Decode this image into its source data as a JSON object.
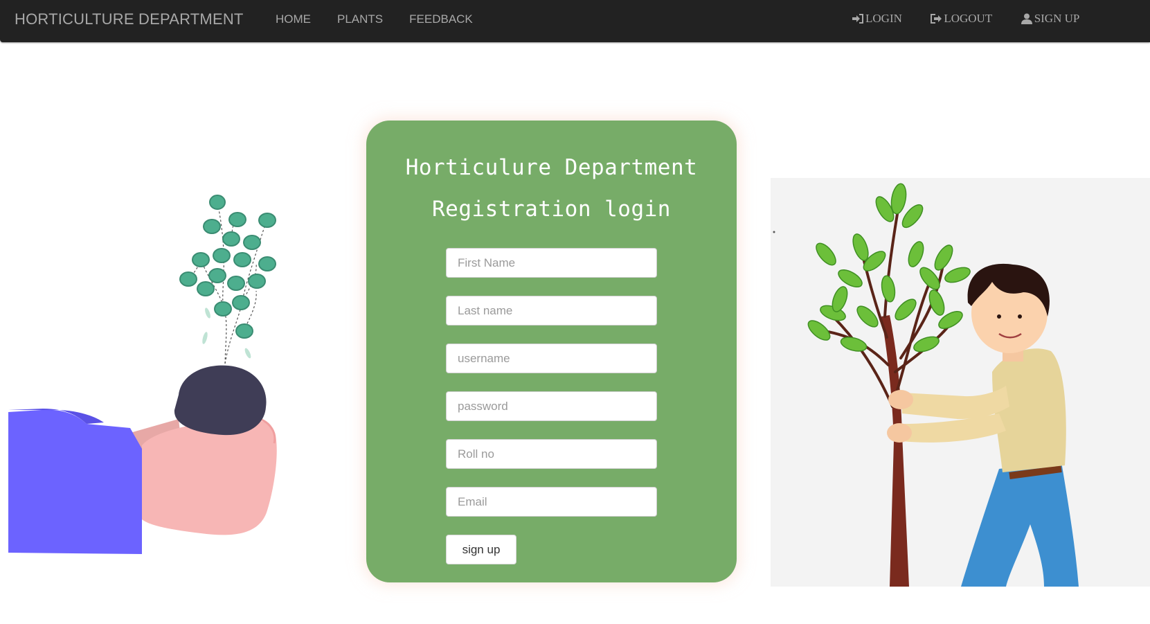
{
  "navbar": {
    "brand": "HORTICULTURE DEPARTMENT",
    "links": [
      "HOME",
      "PLANTS",
      "FEEDBACK"
    ],
    "right": [
      {
        "label": "LOGIN",
        "icon": "login-icon"
      },
      {
        "label": "LOGOUT",
        "icon": "logout-icon"
      },
      {
        "label": "SIGN UP",
        "icon": "user-icon"
      }
    ]
  },
  "form": {
    "title_line1": "Horticulure Department",
    "title_line2": "Registration login",
    "first_name_placeholder": "First Name",
    "last_name_placeholder": "Last name",
    "username_placeholder": "username",
    "password_placeholder": "password",
    "roll_placeholder": "Roll no",
    "email_placeholder": "Email",
    "submit_label": "sign up"
  },
  "colors": {
    "navbar": "#222222",
    "nav_text": "#a8a8a8",
    "card": "#77ac68",
    "card_text": "#ffffff"
  }
}
